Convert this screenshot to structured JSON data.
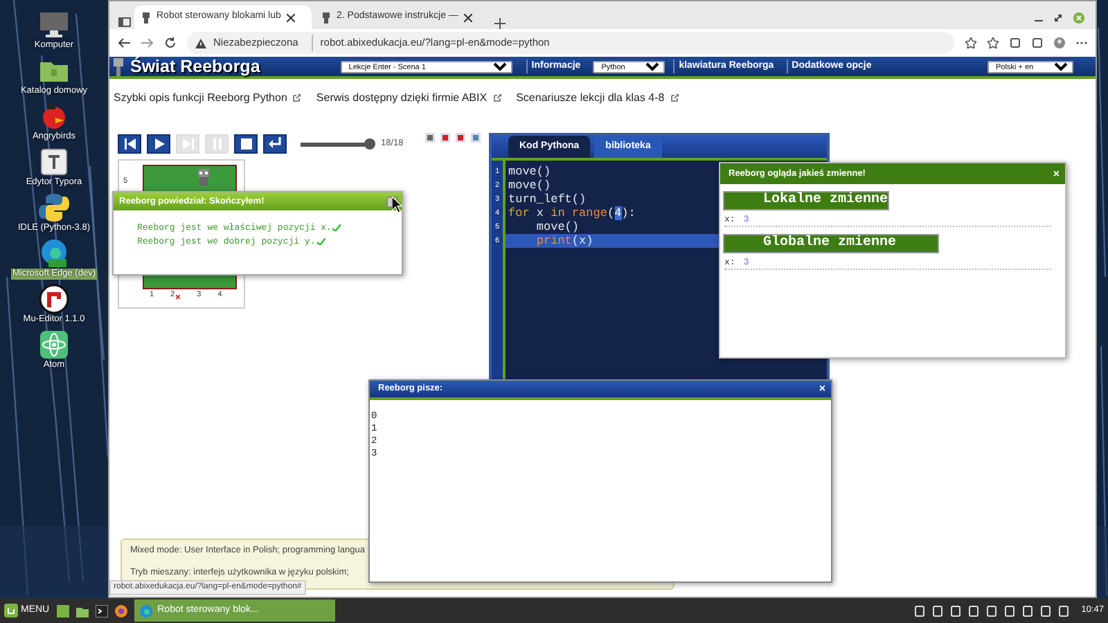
{
  "desktop_icons": [
    {
      "label": "Komputer",
      "kind": "monitor",
      "selected": false
    },
    {
      "label": "Katalog domowy",
      "kind": "folder",
      "selected": false
    },
    {
      "label": "Angrybirds",
      "kind": "bird",
      "selected": false
    },
    {
      "label": "Edytor Typora",
      "kind": "typora",
      "selected": false
    },
    {
      "label": "IDLE (Python-3.8)",
      "kind": "python",
      "selected": false
    },
    {
      "label": "Microsoft Edge (dev)",
      "kind": "edge",
      "selected": true
    },
    {
      "label": "Mu-Editor 1.1.0",
      "kind": "mu",
      "selected": false
    },
    {
      "label": "Atom",
      "kind": "atom",
      "selected": false
    }
  ],
  "browser": {
    "tabs": [
      {
        "title": "Robot sterowany blokami lub",
        "selected": true
      },
      {
        "title": "2. Podstawowe instrukcje —",
        "selected": false
      }
    ],
    "security": "Niezabezpieczona",
    "url": "robot.abixedukacja.eu/?lang=pl-en&mode=python"
  },
  "site_header": {
    "logo": "Świat Reeborga",
    "lesson_select": "Lekcje Enter - Scena 1",
    "info": "Informacje",
    "language_select": "Python",
    "keyboard": "klawiatura Reeborga",
    "options": "Dodatkowe opcje",
    "locale_select": "Polski + en"
  },
  "links": [
    "Szybki opis funkcji Reeborg Python",
    "Serwis dostępny dzięki firmie ABIX",
    "Scenariusze lekcji dla klas 4-8"
  ],
  "playback": {
    "buttons": [
      {
        "kind": "reset",
        "disabled": false
      },
      {
        "kind": "play",
        "disabled": false
      },
      {
        "kind": "step",
        "disabled": true
      },
      {
        "kind": "pause",
        "disabled": true
      },
      {
        "kind": "stop",
        "disabled": false
      },
      {
        "kind": "return",
        "disabled": false
      }
    ],
    "slider": {
      "level": 1
    },
    "reading": "18/18"
  },
  "world": {
    "row_labels": [
      "5"
    ],
    "column_labels": [
      "1",
      "2",
      "3",
      "4"
    ]
  },
  "done_dialog": {
    "title": "Reeborg powiedział: Skończyłem!",
    "lines": [
      "Reeborg jest we właściwej pozycji x.",
      "Reeborg jest we dobrej pozycji y."
    ]
  },
  "editor": {
    "tabs": [
      {
        "label": "Kod Pythona",
        "selected": true
      },
      {
        "label": "biblioteka",
        "selected": false
      }
    ],
    "lines": [
      {
        "number": "1",
        "highlighted": false,
        "tokens": [
          {
            "text": "move()",
            "kind": "plain"
          }
        ]
      },
      {
        "number": "2",
        "highlighted": false,
        "tokens": [
          {
            "text": "move()",
            "kind": "plain"
          }
        ]
      },
      {
        "number": "3",
        "highlighted": false,
        "tokens": [
          {
            "text": "turn_left()",
            "kind": "plain"
          }
        ]
      },
      {
        "number": "4",
        "highlighted": false,
        "tokens": [
          {
            "text": "for",
            "kind": "keyword"
          },
          {
            "text": " x ",
            "kind": "plain"
          },
          {
            "text": "in",
            "kind": "keyword"
          },
          {
            "text": " range",
            "kind": "builtin"
          },
          {
            "text": "(",
            "kind": "plain"
          },
          {
            "text": "4",
            "kind": "match"
          },
          {
            "text": "):",
            "kind": "plain"
          }
        ]
      },
      {
        "number": "5",
        "highlighted": false,
        "tokens": [
          {
            "text": "    move()",
            "kind": "plain"
          }
        ]
      },
      {
        "number": "6",
        "highlighted": true,
        "tokens": [
          {
            "text": "    print",
            "kind": "builtin"
          },
          {
            "text": "(x)",
            "kind": "plain"
          }
        ]
      }
    ]
  },
  "watch_window": {
    "title": "Reeborg ogląda jakieś zmienne!",
    "close": "×",
    "sections": [
      {
        "heading": "Lokalne zmienne",
        "vars": [
          {
            "name": "x:",
            "value": "3"
          }
        ]
      },
      {
        "heading": "Globalne zmienne",
        "vars": [
          {
            "name": "x:",
            "value": "3"
          }
        ]
      }
    ]
  },
  "output_window": {
    "title": "Reeborg pisze:",
    "close": "×",
    "lines": [
      "0",
      "1",
      "2",
      "3"
    ]
  },
  "info_box": [
    "Mixed mode: User Interface in Polish; programming langua",
    "Tryb mieszany: interfejs użytkownika w języku polskim;"
  ],
  "status_url": "robot.abixedukacja.eu/?lang=pl-en&mode=python#",
  "taskbar": {
    "menu": "MENU",
    "task": "Robot sterowany blok...",
    "clock": "10:47"
  }
}
